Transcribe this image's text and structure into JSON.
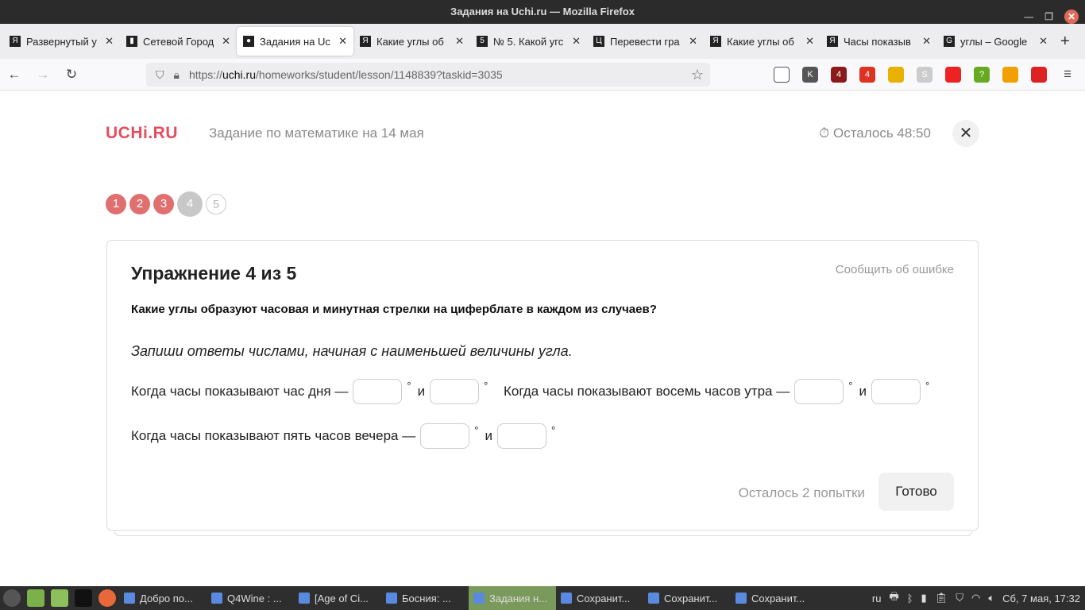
{
  "window": {
    "title": "Задания на Uchi.ru — Mozilla Firefox"
  },
  "tabs": [
    {
      "label": "Развернутый у",
      "icon": "Я"
    },
    {
      "label": "Сетевой Город",
      "icon": "▮"
    },
    {
      "label": "Задания на Uc",
      "icon": "●",
      "active": true
    },
    {
      "label": "Какие углы об",
      "icon": "Я"
    },
    {
      "label": "№ 5. Какой угс",
      "icon": "5"
    },
    {
      "label": "Перевести гра",
      "icon": "Ц"
    },
    {
      "label": "Какие углы об",
      "icon": "Я"
    },
    {
      "label": "Часы показыв",
      "icon": "Я"
    },
    {
      "label": "углы – Google",
      "icon": "G"
    }
  ],
  "url": {
    "prefix": "https://",
    "domain": "uchi.ru",
    "path": "/homeworks/student/lesson/1148839?taskid=3035"
  },
  "extensions": [
    {
      "badge": ""
    },
    {
      "badge": "K"
    },
    {
      "badge": "4"
    },
    {
      "badge": "4"
    },
    {
      "badge": ""
    },
    {
      "badge": "S"
    },
    {
      "badge": ""
    },
    {
      "badge": "?"
    },
    {
      "badge": ""
    },
    {
      "badge": ""
    }
  ],
  "header": {
    "logo": "UCHi.RU",
    "subtitle": "Задание по математике на 14 мая",
    "timer": "Осталось 48:50"
  },
  "steps": [
    "1",
    "2",
    "3",
    "4",
    "5"
  ],
  "card": {
    "title": "Упражнение 4 из 5",
    "report": "Сообщить об ошибке",
    "question": "Какие углы образуют часовая и минутная стрелки на циферблате в каждом из случаев?",
    "hint": "Запиши ответы числами, начиная с наименьшей величины угла.",
    "items": [
      {
        "text": "Когда часы показывают час дня —",
        "a": "",
        "b": ""
      },
      {
        "text": "Когда часы показывают восемь часов утра —",
        "a": "",
        "b": ""
      },
      {
        "text": "Когда часы показывают пять часов вечера —",
        "a": "",
        "b": ""
      }
    ],
    "deg": "°",
    "and": "и",
    "tries": "Осталось 2 попытки",
    "done": "Готово"
  },
  "taskbar": {
    "items": [
      "Добро по...",
      "Q4Wine : ...",
      "[Age of Ci...",
      "Босния: ...",
      "Задания н...",
      "Сохранит...",
      "Сохранит...",
      "Сохранит..."
    ],
    "lang": "ru",
    "clock": "Сб, 7 мая, 17:32"
  }
}
